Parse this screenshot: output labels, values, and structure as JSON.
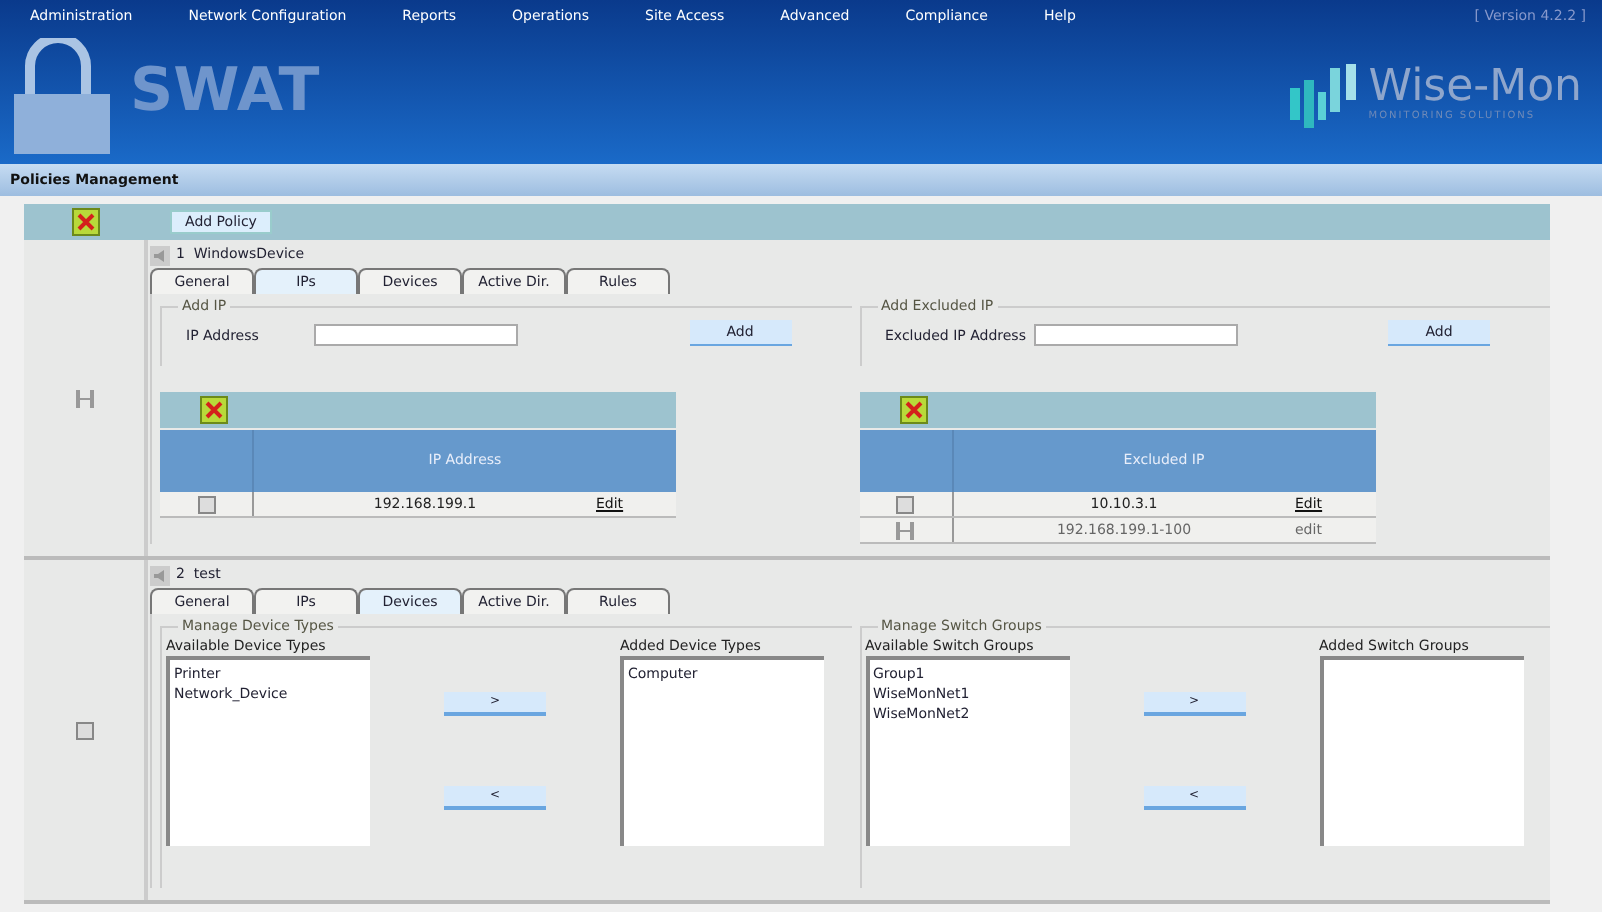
{
  "menu": [
    {
      "label": "Administration"
    },
    {
      "label": "Network Configuration"
    },
    {
      "label": "Reports"
    },
    {
      "label": "Operations"
    },
    {
      "label": "Site Access"
    },
    {
      "label": "Advanced"
    },
    {
      "label": "Compliance"
    },
    {
      "label": "Help"
    }
  ],
  "version": "[ Version 4.2.2 ]",
  "logo": {
    "title": "SWAT"
  },
  "brand": {
    "name": "Wise-Mon",
    "tagline": "MONITORING SOLUTIONS"
  },
  "page_title": "Policies Management",
  "toolbar": {
    "add_button": "Add Policy"
  },
  "policies": [
    {
      "kind": "ips",
      "number": "1",
      "name": "WindowsDevice",
      "checkbox_disabled": true,
      "tabs": [
        {
          "label": "General",
          "selected": false
        },
        {
          "label": "IPs",
          "selected": true
        },
        {
          "label": "Devices",
          "selected": false
        },
        {
          "label": "Active Dir.",
          "selected": false
        },
        {
          "label": "Rules",
          "selected": false
        }
      ],
      "groups": [
        {
          "legend": "Add IP",
          "field_label": "IP Address",
          "button": "Add",
          "column": "IP Address",
          "rows": [
            {
              "value": "192.168.199.1",
              "link": "Edit",
              "disabled": false
            }
          ]
        },
        {
          "legend": "Add Excluded IP",
          "field_label": "Excluded IP Address",
          "button": "Add",
          "column": "Excluded IP",
          "rows": [
            {
              "value": "10.10.3.1",
              "link": "Edit",
              "disabled": false
            },
            {
              "value": "192.168.199.1-100",
              "link": "edit",
              "disabled": true
            }
          ]
        }
      ]
    },
    {
      "kind": "devices",
      "number": "2",
      "name": "test",
      "checkbox_disabled": false,
      "tabs": [
        {
          "label": "General",
          "selected": false
        },
        {
          "label": "IPs",
          "selected": false
        },
        {
          "label": "Devices",
          "selected": true
        },
        {
          "label": "Active Dir.",
          "selected": false
        },
        {
          "label": "Rules",
          "selected": false
        }
      ],
      "groups": [
        {
          "legend": "Manage Device Types",
          "available_label": "Available Device Types",
          "available": [
            "Printer",
            "Network_Device"
          ],
          "added_label": "Added Device Types",
          "added": [
            "Computer"
          ],
          "buttons": [
            ">",
            "<"
          ]
        },
        {
          "legend": "Manage Switch Groups",
          "available_label": "Available Switch Groups",
          "available": [
            "Group1",
            "WiseMonNet1",
            "WiseMonNet2"
          ],
          "added_label": "Added Switch Groups",
          "buttons": [
            ">",
            "<"
          ]
        }
      ]
    }
  ]
}
